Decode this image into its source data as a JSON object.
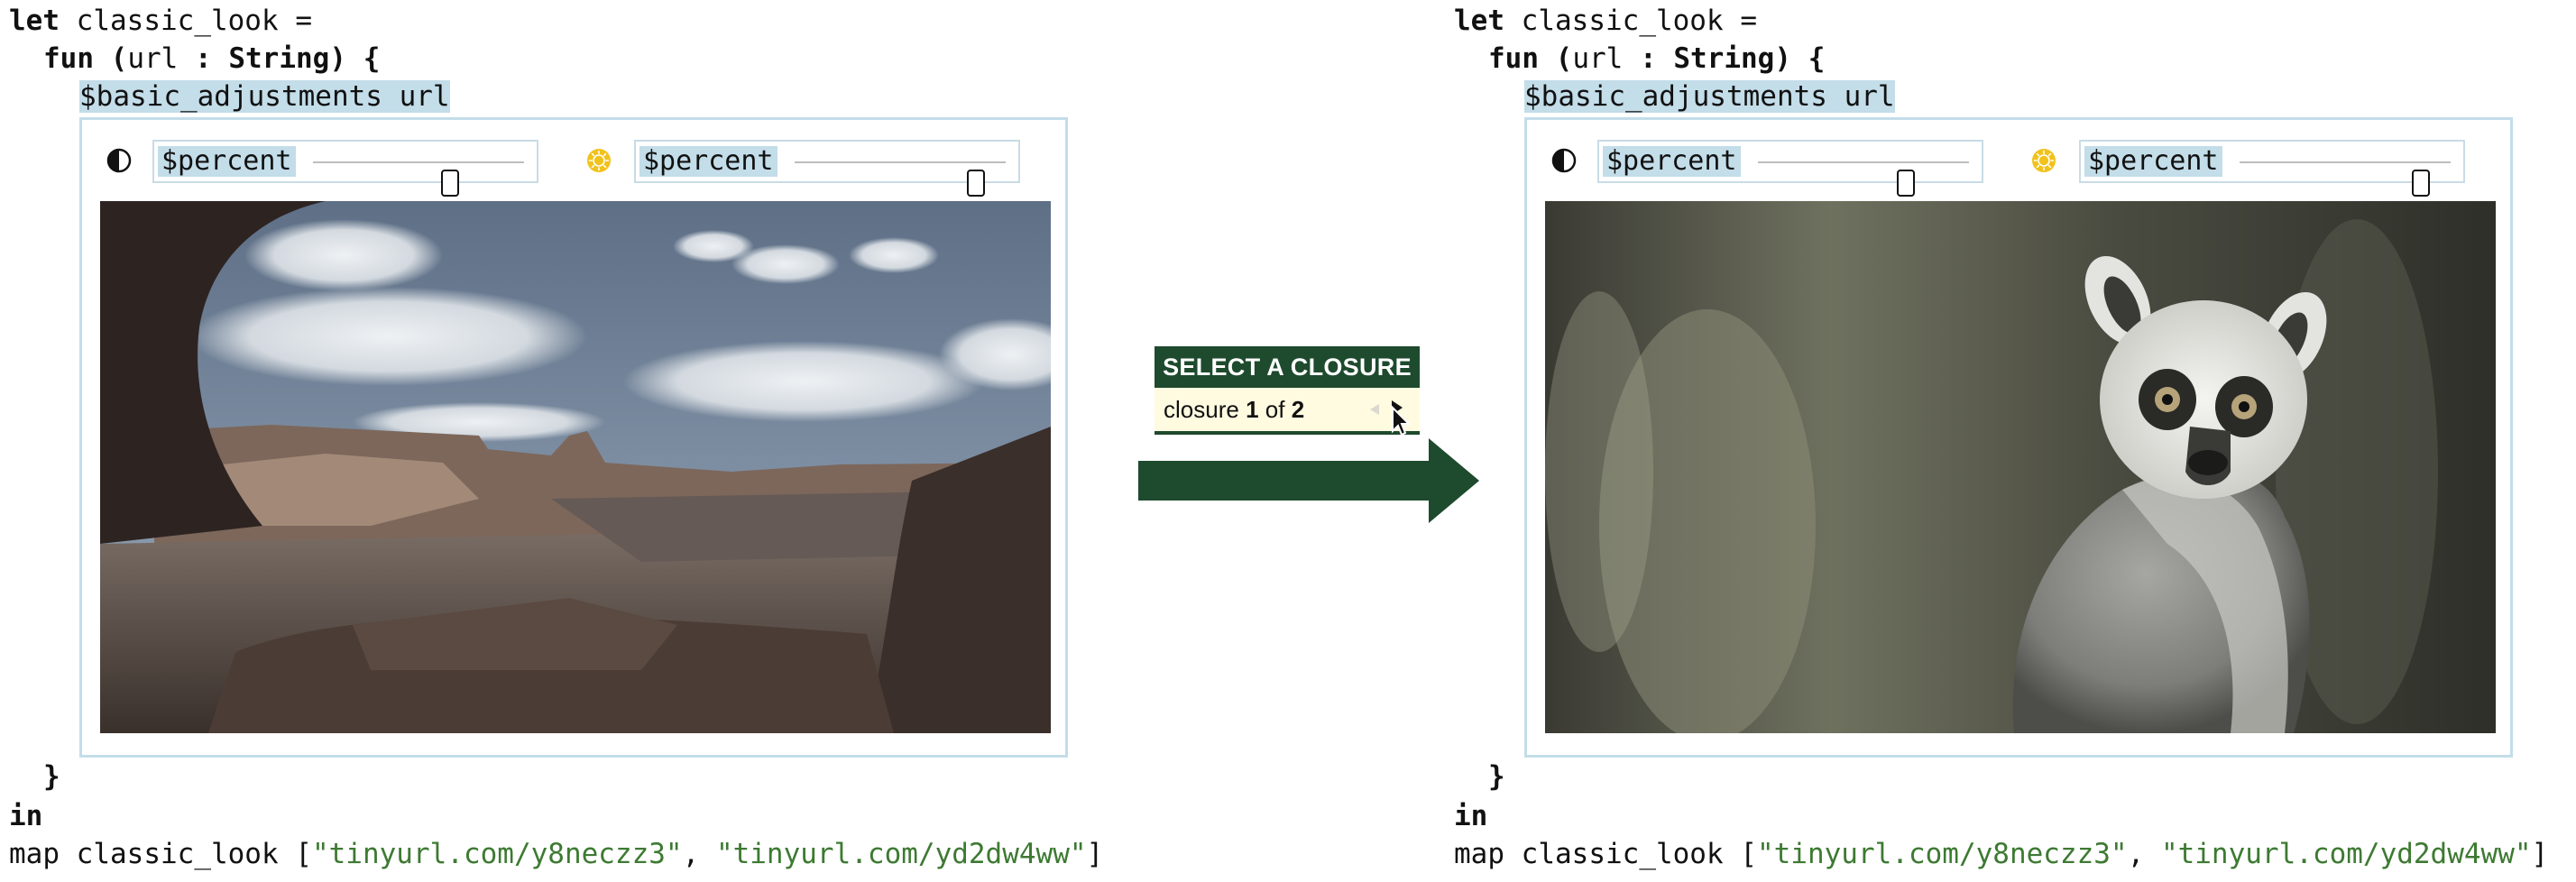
{
  "code": {
    "kw_let": "let",
    "name": "classic_look",
    "eq": "=",
    "kw_fun": "fun",
    "paren_open": "(",
    "param": "url",
    "colon": ":",
    "type": "String",
    "paren_close": ")",
    "brace_open": "{",
    "brace_close": "}",
    "kw_in": "in",
    "map_fn": "map",
    "bracket_open": "[",
    "url1": "\"tinyurl.com/y8neczz3\"",
    "comma": ",",
    "url2": "\"tinyurl.com/yd2dw4ww\"",
    "bracket_close": "]"
  },
  "widget": {
    "hole_label": "$basic_adjustments url",
    "contrast_slider": {
      "label": "$percent"
    },
    "brightness_slider": {
      "label": "$percent"
    }
  },
  "left_panel": {
    "contrast_value": 0.65,
    "brightness_value": 0.86
  },
  "right_panel": {
    "contrast_value": 0.7,
    "brightness_value": 0.86
  },
  "closure_selector": {
    "title": "SELECT A CLOSURE",
    "prefix": "closure",
    "current": "1",
    "of": "of",
    "total": "2"
  },
  "colors": {
    "highlight": "#c3dde9",
    "selector_header": "#1e4a2e",
    "selector_body": "#fffbe0",
    "string": "#3d7a32"
  },
  "icons": [
    "contrast-icon",
    "sun-icon",
    "prev-icon",
    "next-icon",
    "cursor-icon",
    "arrow-right-icon"
  ]
}
